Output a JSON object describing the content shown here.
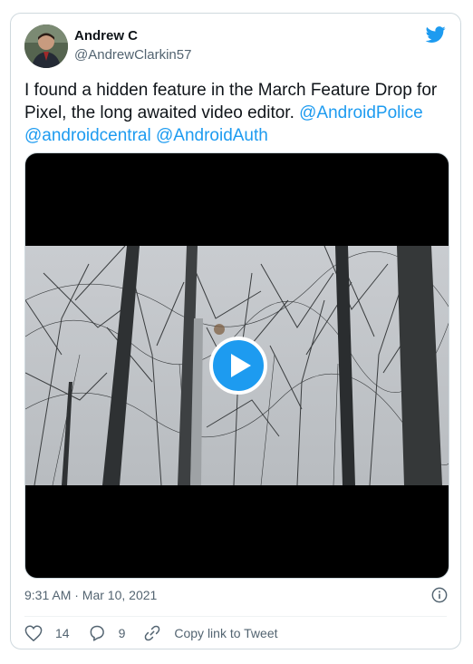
{
  "author": {
    "name": "Andrew C",
    "handle": "@AndrewClarkin57"
  },
  "tweet": {
    "text_plain": "I found a hidden feature in the March Feature Drop for Pixel, the long awaited video editor.",
    "mentions": [
      "@AndroidPolice",
      "@androidcentral",
      "@AndroidAuth"
    ]
  },
  "media": {
    "type": "video",
    "play_icon": "play-icon"
  },
  "meta": {
    "timestamp": "9:31 AM · Mar 10, 2021",
    "info_icon": "info-icon"
  },
  "actions": {
    "like_count": "14",
    "reply_count": "9",
    "copy_link_label": "Copy link to Tweet"
  },
  "colors": {
    "accent": "#1d9bf0",
    "text": "#0f1419",
    "muted": "#536471",
    "border": "#cfd9de"
  }
}
